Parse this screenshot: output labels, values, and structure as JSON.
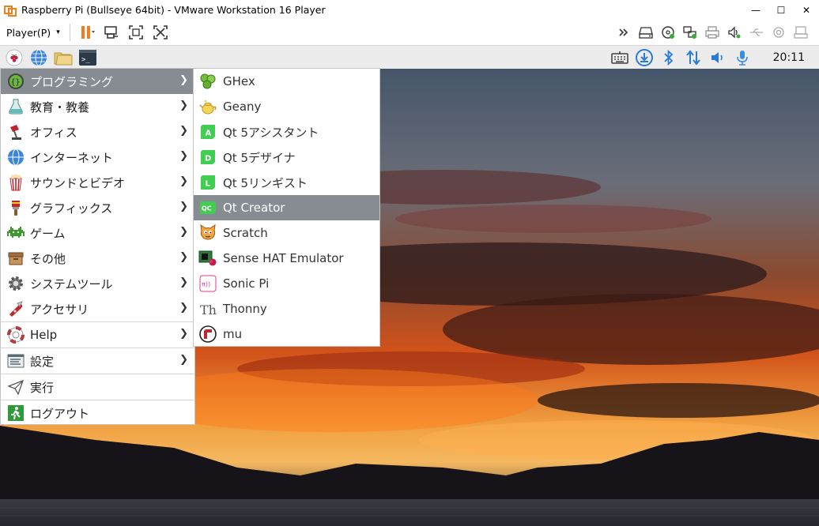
{
  "window": {
    "title": "Raspberry Pi (Bullseye 64bit) - VMware Workstation 16 Player",
    "minimize": "—",
    "maximize": "☐",
    "close": "✕"
  },
  "toolbar": {
    "player_menu": "Player(P)",
    "caret": "▾"
  },
  "panel": {
    "clock": "20:11"
  },
  "main_menu": {
    "items": [
      {
        "label": "プログラミング"
      },
      {
        "label": "教育・教養"
      },
      {
        "label": "オフィス"
      },
      {
        "label": "インターネット"
      },
      {
        "label": "サウンドとビデオ"
      },
      {
        "label": "グラフィックス"
      },
      {
        "label": "ゲーム"
      },
      {
        "label": "その他"
      },
      {
        "label": "システムツール"
      },
      {
        "label": "アクセサリ"
      },
      {
        "label": "Help"
      },
      {
        "label": "設定"
      },
      {
        "label": "実行"
      },
      {
        "label": "ログアウト"
      }
    ],
    "arrow": "❯"
  },
  "sub_menu": {
    "items": [
      {
        "label": "GHex"
      },
      {
        "label": "Geany"
      },
      {
        "label": "Qt 5アシスタント"
      },
      {
        "label": "Qt 5デザイナ"
      },
      {
        "label": "Qt 5リンギスト"
      },
      {
        "label": "Qt Creator"
      },
      {
        "label": "Scratch"
      },
      {
        "label": "Sense HAT Emulator"
      },
      {
        "label": "Sonic Pi"
      },
      {
        "label": "Thonny"
      },
      {
        "label": "mu"
      }
    ],
    "icon_texts": {
      "qt_a": "A",
      "qt_d": "D",
      "qt_l": "L",
      "qtcreator": "QC",
      "thonny": "Th",
      "sonicpi": "π))",
      "terminal": ">_"
    }
  },
  "colors": {
    "menu_highlight": "#878c92",
    "panel_bg": "#ececec",
    "vmware_orange": "#f07d1e"
  }
}
